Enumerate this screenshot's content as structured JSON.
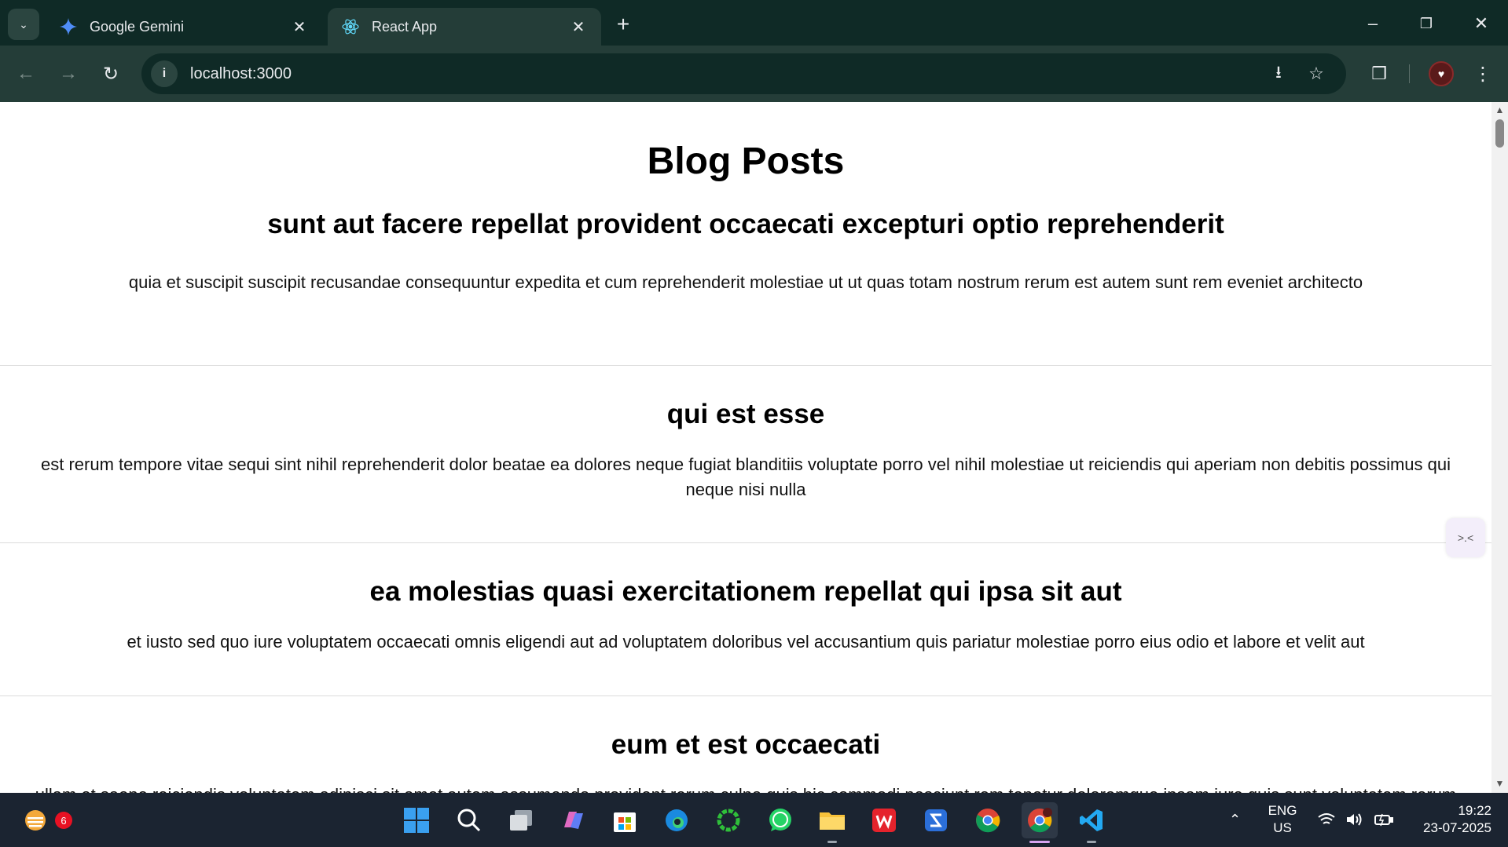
{
  "browser": {
    "tabs": [
      {
        "title": "Google Gemini",
        "favicon": "gemini-icon",
        "active": false
      },
      {
        "title": "React App",
        "favicon": "react-icon",
        "active": true
      }
    ],
    "url": "localhost:3000"
  },
  "page": {
    "heading": "Blog Posts",
    "posts": [
      {
        "title": "sunt aut facere repellat provident occaecati excepturi optio reprehenderit",
        "body": "quia et suscipit suscipit recusandae consequuntur expedita et cum reprehenderit molestiae ut ut quas totam nostrum rerum est autem sunt rem eveniet architecto"
      },
      {
        "title": "qui est esse",
        "body": "est rerum tempore vitae sequi sint nihil reprehenderit dolor beatae ea dolores neque fugiat blanditiis voluptate porro vel nihil molestiae ut reiciendis qui aperiam non debitis possimus qui neque nisi nulla"
      },
      {
        "title": "ea molestias quasi exercitationem repellat qui ipsa sit aut",
        "body": "et iusto sed quo iure voluptatem occaecati omnis eligendi aut ad voluptatem doloribus vel accusantium quis pariatur molestiae porro eius odio et labore et velit aut"
      },
      {
        "title": "eum et est occaecati",
        "body": "ullam et saepe reiciendis voluptatem adipisci sit amet autem assumenda provident rerum culpa quis hic commodi nesciunt rem tenetur doloremque ipsam iure quis sunt voluptatem rerum illo velit"
      }
    ]
  },
  "taskbar": {
    "widgets_badge": "6",
    "language": "ENG",
    "region": "US",
    "time": "19:22",
    "date": "23-07-2025"
  },
  "colors": {
    "tabstrip": "#0f2a26",
    "toolbar": "#243d38",
    "taskbar": "#1b2431"
  }
}
